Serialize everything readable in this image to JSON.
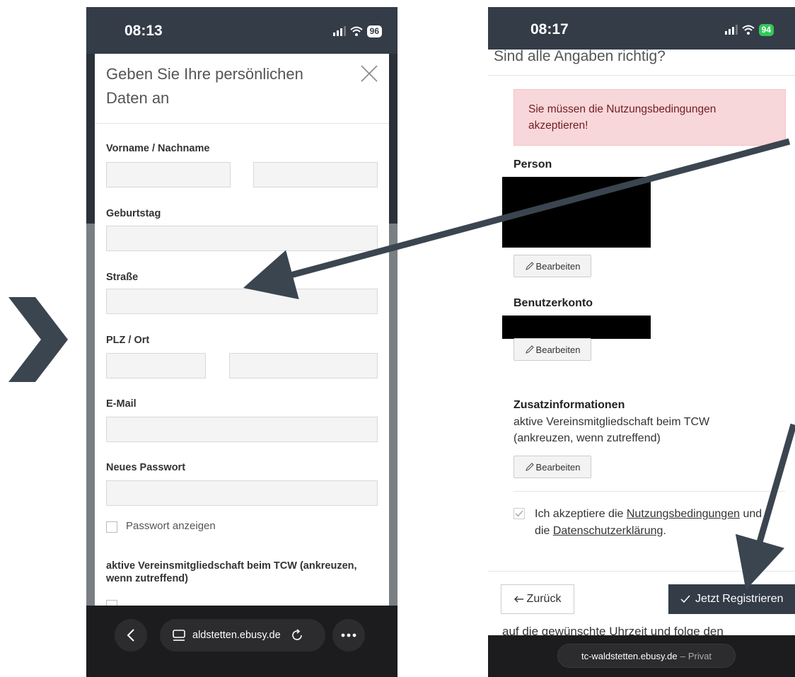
{
  "left_phone": {
    "status": {
      "time": "08:13",
      "battery": "96"
    },
    "modal": {
      "title": "Geben Sie Ihre persönlichen Daten an",
      "fields": {
        "name_label": "Vorname / Nachname",
        "birthday_label": "Geburtstag",
        "street_label": "Straße",
        "zip_city_label": "PLZ / Ort",
        "email_label": "E-Mail",
        "password_label": "Neues Passwort",
        "show_password_label": "Passwort anzeigen",
        "membership_label": "aktive Vereinsmitgliedschaft beim TCW (ankreuzen, wenn zutreffend)"
      }
    },
    "browser": {
      "url": "aldstetten.ebusy.de"
    }
  },
  "right_phone": {
    "status": {
      "time": "08:17",
      "battery": "94"
    },
    "heading_cut": "Sind alle Angaben richtig?",
    "alert": "Sie müssen die Nutzungsbedingungen akzeptieren!",
    "person_label": "Person",
    "account_label": "Benutzerkonto",
    "extra_label": "Zusatzinformationen",
    "extra_text_1": "aktive Vereinsmitgliedschaft beim TCW",
    "extra_text_2": "(ankreuzen, wenn zutreffend)",
    "edit_label": "Bearbeiten",
    "accept_prefix": "Ich akzeptiere die",
    "terms_link": "Nutzungsbedingungen",
    "accept_mid": "und",
    "accept_line2_prefix": "die",
    "privacy_link": "Datenschutzerklärung",
    "accept_suffix": ".",
    "back_label": "Zurück",
    "register_label": "Jetzt Registrieren",
    "bottom_cut_text": "auf die gewünschte Uhrzeit und folge den",
    "browser": {
      "url": "tc-waldstetten.ebusy.de",
      "separator": "–",
      "mode": "Privat"
    }
  },
  "colors": {
    "accent": "#333c47",
    "alert_bg": "#f8d7da",
    "alert_text": "#721c24"
  }
}
